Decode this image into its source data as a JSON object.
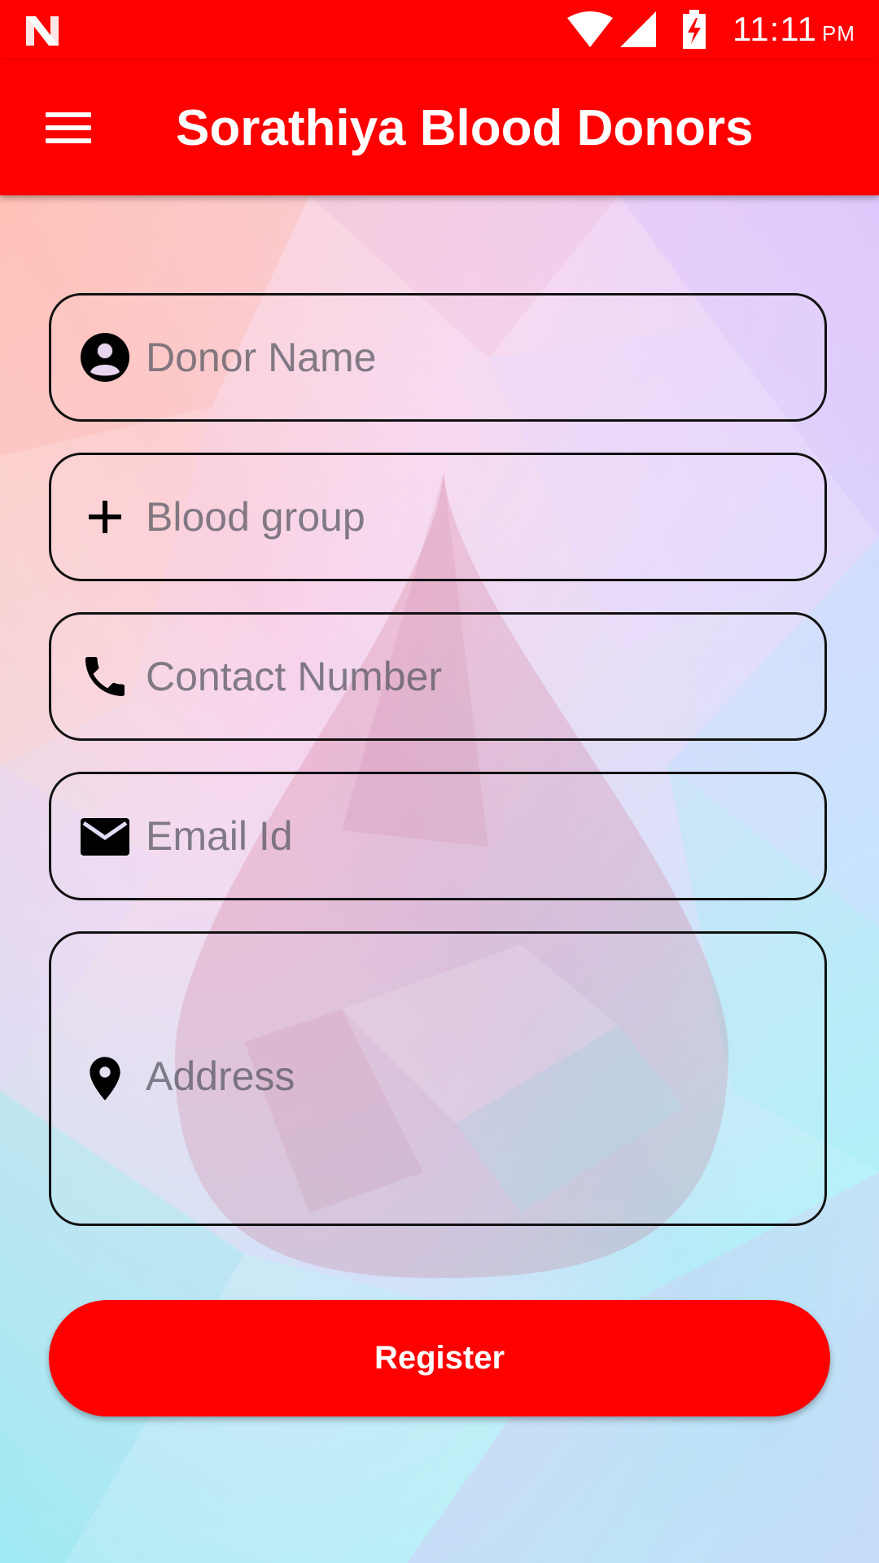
{
  "status_bar": {
    "time": "11:11",
    "ampm": "PM",
    "icons": [
      "n-logo-icon",
      "wifi-icon",
      "cell-signal-icon",
      "battery-charging-icon"
    ]
  },
  "app_bar": {
    "title": "Sorathiya Blood Donors",
    "menu_icon": "hamburger-menu-icon",
    "color": "#ff0000"
  },
  "form": {
    "fields": [
      {
        "icon": "account-circle-icon",
        "placeholder": "Donor Name",
        "value": ""
      },
      {
        "icon": "plus-icon",
        "placeholder": "Blood group",
        "value": ""
      },
      {
        "icon": "phone-icon",
        "placeholder": "Contact Number",
        "value": ""
      },
      {
        "icon": "mail-icon",
        "placeholder": "Email Id",
        "value": ""
      },
      {
        "icon": "location-pin-icon",
        "placeholder": "Address",
        "value": ""
      }
    ],
    "register_label": "Register",
    "register_color": "#ff0000"
  }
}
